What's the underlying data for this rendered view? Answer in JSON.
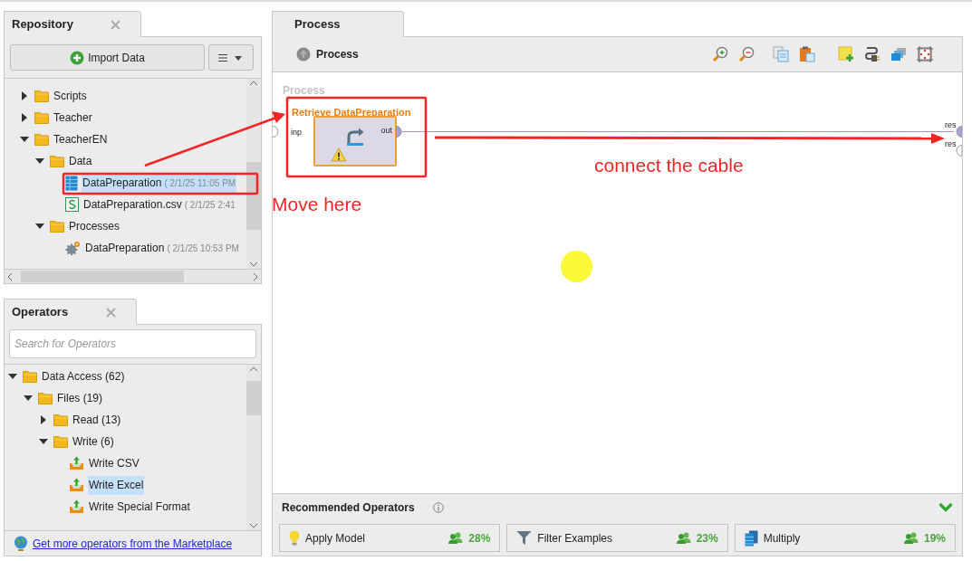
{
  "repository": {
    "tab": "Repository",
    "import_button": "Import Data",
    "tree": [
      {
        "kind": "folder",
        "label": "Scripts",
        "expanded": false
      },
      {
        "kind": "folder",
        "label": "Teacher",
        "expanded": false
      },
      {
        "kind": "folder",
        "label": "TeacherEN",
        "expanded": true,
        "children": [
          {
            "kind": "folder",
            "label": "Data",
            "expanded": true,
            "children": [
              {
                "kind": "data",
                "label": "DataPreparation",
                "date": "( 2/1/25 11:05 PM",
                "selected": true
              },
              {
                "kind": "csv",
                "label": "DataPreparation.csv",
                "date": "( 2/1/25 2:41",
                "selected": false
              }
            ]
          },
          {
            "kind": "folder",
            "label": "Processes",
            "expanded": true,
            "children": [
              {
                "kind": "process",
                "label": "DataPreparation",
                "date": "( 2/1/25 10:53 PM",
                "selected": false
              }
            ]
          }
        ]
      }
    ]
  },
  "operators": {
    "tab": "Operators",
    "search_placeholder": "Search for Operators",
    "tree": [
      {
        "kind": "folder",
        "label": "Data Access (62)",
        "expanded": true,
        "children": [
          {
            "kind": "folder",
            "label": "Files (19)",
            "expanded": true,
            "children": [
              {
                "kind": "folder",
                "label": "Read (13)",
                "expanded": false
              },
              {
                "kind": "folder",
                "label": "Write (6)",
                "expanded": true,
                "children": [
                  {
                    "kind": "write",
                    "label": "Write CSV",
                    "selected": false
                  },
                  {
                    "kind": "write",
                    "label": "Write Excel",
                    "selected": true
                  },
                  {
                    "kind": "write",
                    "label": "Write Special Format",
                    "selected": false
                  }
                ]
              }
            ]
          }
        ]
      }
    ],
    "marketplace_link": "Get more operators from the Marketplace"
  },
  "process": {
    "tab": "Process",
    "breadcrumb": "Process",
    "canvas_label": "Process",
    "operator": {
      "title": "Retrieve DataPreparation",
      "input_port": "inp",
      "output_port": "out",
      "warning": true
    },
    "result_ports": [
      {
        "label": "res",
        "connected": true
      },
      {
        "label": "res",
        "connected": false
      }
    ],
    "recommended": {
      "title": "Recommended Operators",
      "items": [
        {
          "kind": "bulb",
          "name": "Apply Model",
          "share": "28%"
        },
        {
          "kind": "filter",
          "name": "Filter Examples",
          "share": "23%"
        },
        {
          "kind": "multiply",
          "name": "Multiply",
          "share": "19%"
        }
      ]
    }
  },
  "annotations": {
    "move_note": "Move here",
    "cable_note": "connect the cable"
  }
}
